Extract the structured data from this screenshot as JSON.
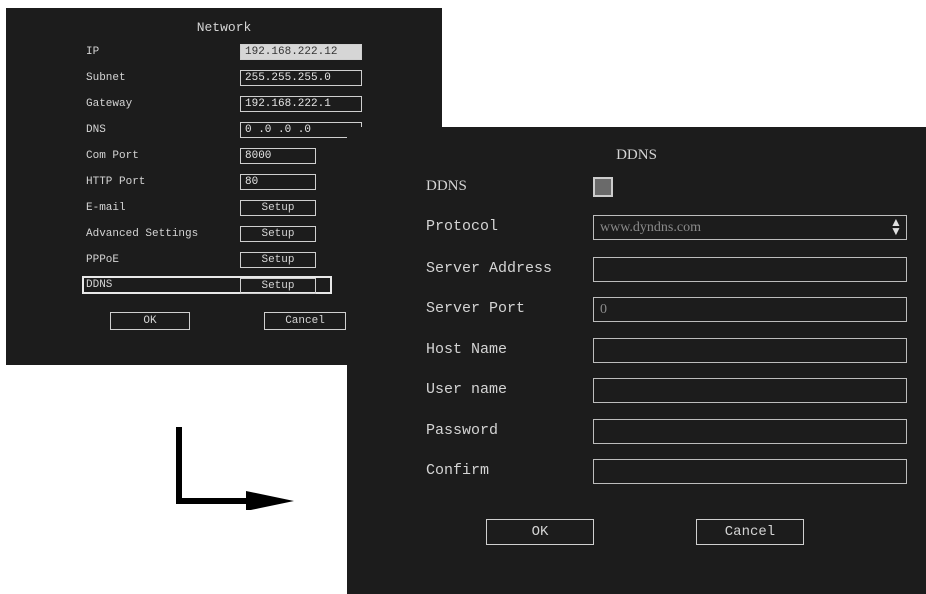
{
  "network": {
    "title": "Network",
    "rows": [
      {
        "label": "IP",
        "value": "192.168.222.12"
      },
      {
        "label": "Subnet",
        "value": "255.255.255.0"
      },
      {
        "label": "Gateway",
        "value": "192.168.222.1"
      },
      {
        "label": "DNS",
        "value": "0  .0  .0  .0"
      },
      {
        "label": "Com Port",
        "value": "8000"
      },
      {
        "label": "HTTP Port",
        "value": "80"
      },
      {
        "label": "E-mail",
        "value": "Setup"
      },
      {
        "label": "Advanced Settings",
        "value": "Setup"
      },
      {
        "label": "PPPoE",
        "value": "Setup"
      },
      {
        "label": "DDNS",
        "value": "Setup"
      }
    ],
    "ok_label": "OK",
    "cancel_label": "Cancel"
  },
  "ddns": {
    "title": "DDNS",
    "labels": {
      "ddns": "DDNS",
      "protocol": "Protocol",
      "server_address": "Server Address",
      "server_port": "Server Port",
      "host_name": "Host Name",
      "user_name": "User name",
      "password": "Password",
      "confirm": "Confirm"
    },
    "values": {
      "protocol": "www.dyndns.com",
      "server_address": "",
      "server_port": "0",
      "host_name": "",
      "user_name": "",
      "password": "",
      "confirm": ""
    },
    "ok_label": "OK",
    "cancel_label": "Cancel"
  },
  "colors": {
    "window_bg": "#1c1c1c",
    "text": "#d4d4d4",
    "page_bg": "#ffffff",
    "arrow": "#000000"
  }
}
